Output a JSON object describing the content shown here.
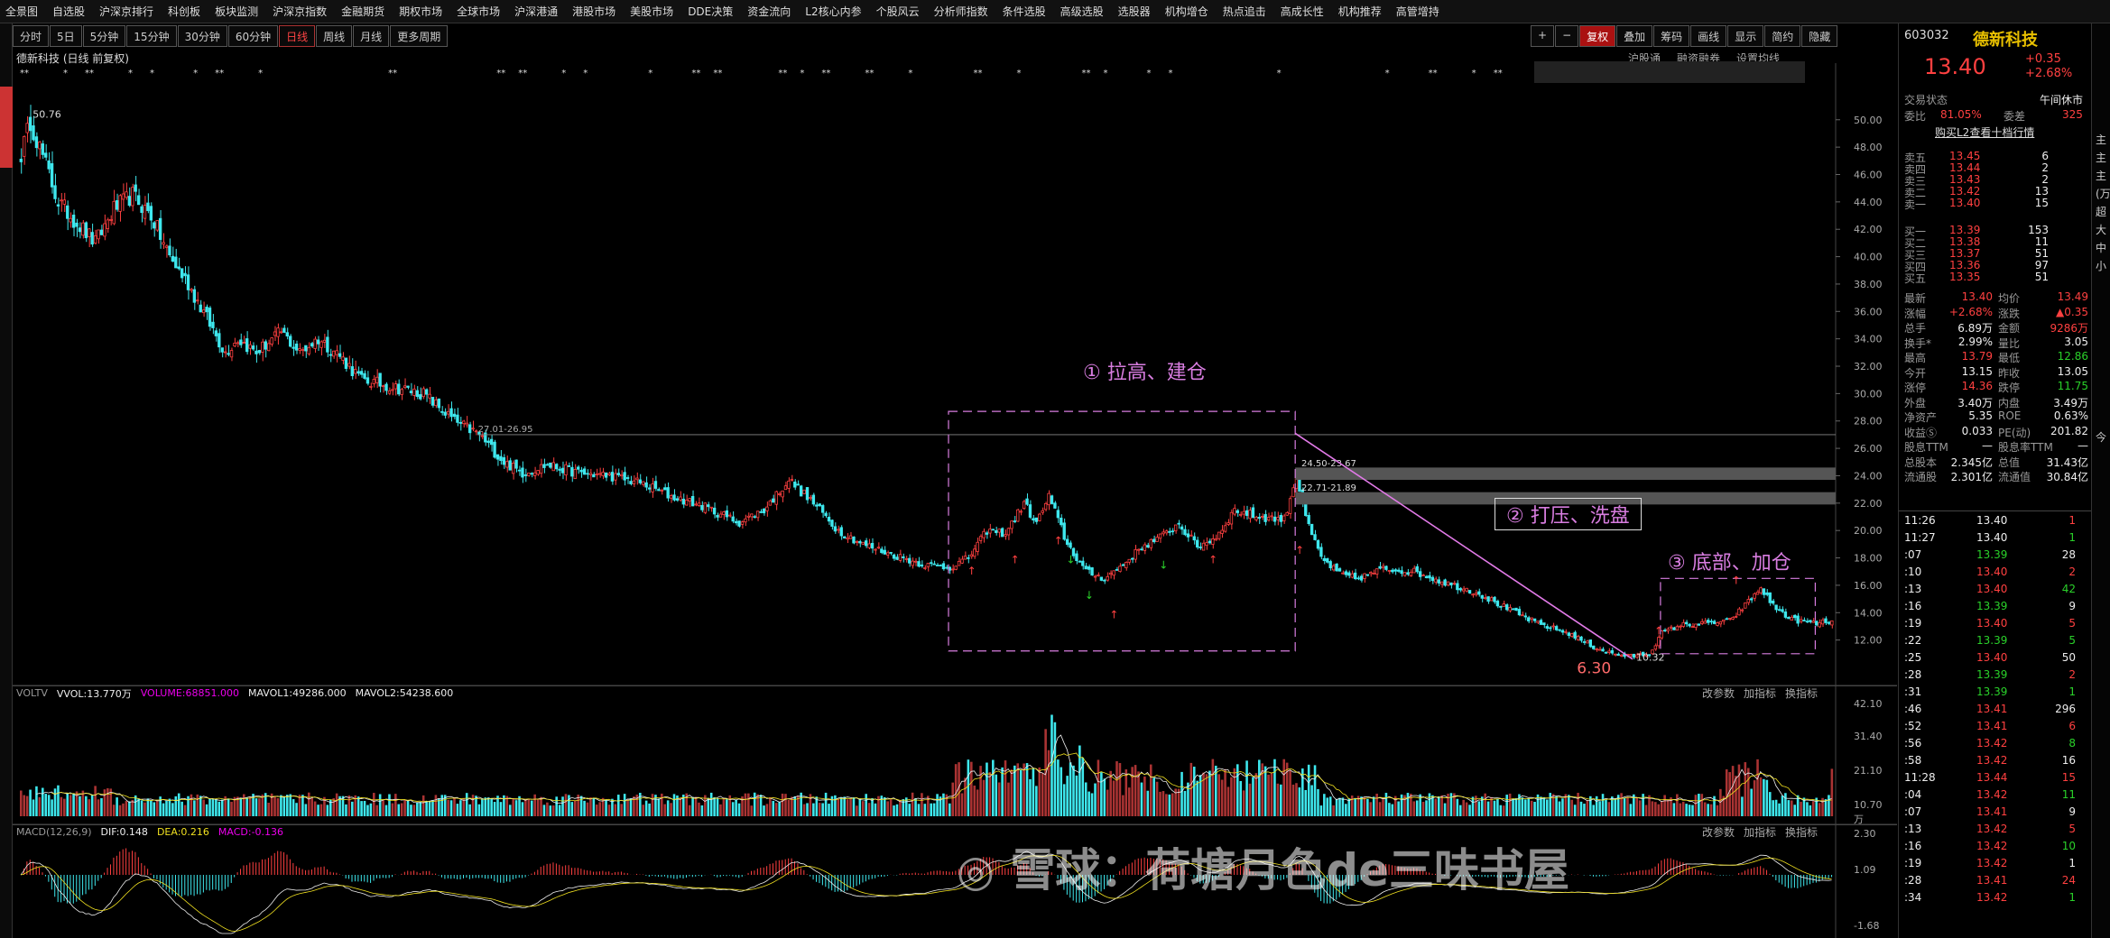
{
  "top_nav": [
    "全景图",
    "自选股",
    "沪深京排行",
    "科创板",
    "板块监测",
    "沪深京指数",
    "金融期货",
    "期权市场",
    "全球市场",
    "沪深港通",
    "港股市场",
    "美股市场",
    "DDE决策",
    "资金流向",
    "L2核心内参",
    "个股风云",
    "分析师指数",
    "条件选股",
    "高级选股",
    "选股器",
    "机构增仓",
    "热点追击",
    "高成长性",
    "机构推荐",
    "高管增持"
  ],
  "period_tabs": [
    "分时",
    "5日",
    "5分钟",
    "15分钟",
    "30分钟",
    "60分钟",
    "日线",
    "周线",
    "月线",
    "更多周期"
  ],
  "active_period": "日线",
  "chart_tools": [
    "+",
    "−",
    "复权",
    "叠加",
    "筹码",
    "画线",
    "显示",
    "简约",
    "隐藏"
  ],
  "chart_subtools": [
    "沪股通",
    "融资融券",
    "设置均线"
  ],
  "stock": {
    "title": "德新科技 (日线 前复权)",
    "code": "603032",
    "name": "德新科技",
    "price": "13.40",
    "change": "+0.35",
    "pct": "+2.68%"
  },
  "price_axis": [
    "50.00",
    "48.00",
    "46.00",
    "44.00",
    "42.00",
    "40.00",
    "38.00",
    "36.00",
    "34.00",
    "32.00",
    "30.00",
    "28.00",
    "26.00",
    "24.00",
    "22.00",
    "20.00",
    "18.00",
    "16.00",
    "14.00",
    "12.00"
  ],
  "price_labels": {
    "high": "50.76",
    "low1": "6.30",
    "low2": "10.32",
    "range1": "27.01-26.95",
    "range2": "24.50-23.67",
    "range3": "22.71-21.89"
  },
  "annotations": [
    "① 拉高、建仓",
    "② 打压、洗盘",
    "③ 底部、加仓"
  ],
  "vol_header": {
    "title": "VOLTV",
    "vvol": "VVOL:13.770万",
    "volume": "VOLUME:68851.000",
    "mavol1": "MAVOL1:49286.000",
    "mavol2": "MAVOL2:54238.600"
  },
  "vol_axis": [
    "42.10",
    "31.40",
    "21.10",
    "10.70",
    "万"
  ],
  "macd_header": {
    "title": "MACD(12,26,9)",
    "dif": "DIF:0.148",
    "dea": "DEA:0.216",
    "macd": "MACD:-0.136"
  },
  "macd_axis": [
    "2.30",
    "1.09",
    "-1.68"
  ],
  "sub_links": [
    "改参数",
    "加指标",
    "换指标"
  ],
  "watermark": "雪球：荷塘月色de三味书屋",
  "rp": {
    "status_label": "交易状态",
    "status": "午间休市",
    "ratio_label": "委比",
    "ratio": "81.05%",
    "diff_label": "委差",
    "diff": "325",
    "l2_link": "购买L2查看十档行情",
    "asks": [
      [
        "卖五",
        "13.45",
        "6"
      ],
      [
        "卖四",
        "13.44",
        "2"
      ],
      [
        "卖三",
        "13.43",
        "2"
      ],
      [
        "卖二",
        "13.42",
        "13"
      ],
      [
        "卖一",
        "13.40",
        "15"
      ]
    ],
    "bids": [
      [
        "买一",
        "13.39",
        "153"
      ],
      [
        "买二",
        "13.38",
        "11"
      ],
      [
        "买三",
        "13.37",
        "51"
      ],
      [
        "买四",
        "13.36",
        "97"
      ],
      [
        "买五",
        "13.35",
        "51"
      ]
    ],
    "stats": [
      [
        "最新",
        "13.40",
        "均价",
        "13.49"
      ],
      [
        "涨幅",
        "+2.68%",
        "涨跌",
        "▲0.35"
      ],
      [
        "总手",
        "6.89万",
        "金额",
        "9286万"
      ],
      [
        "换手*",
        "2.99%",
        "量比",
        "3.05"
      ],
      [
        "最高",
        "13.79",
        "最低",
        "12.86"
      ],
      [
        "今开",
        "13.15",
        "昨收",
        "13.05"
      ],
      [
        "涨停",
        "14.36",
        "跌停",
        "11.75"
      ],
      [
        "外盘",
        "3.40万",
        "内盘",
        "3.49万"
      ],
      [
        "净资产",
        "5.35",
        "ROE",
        "0.63%"
      ],
      [
        "收益Ⓢ",
        "0.033",
        "PE(动)",
        "201.82"
      ],
      [
        "股息TTM",
        "—",
        "股息率TTM",
        "—"
      ],
      [
        "总股本",
        "2.345亿",
        "总值",
        "31.43亿"
      ],
      [
        "流通股",
        "2.301亿",
        "流通值",
        "30.84亿"
      ]
    ],
    "ticks": [
      [
        "11:26",
        "13.40",
        "1"
      ],
      [
        "11:27",
        "13.40",
        "1"
      ],
      [
        ":07",
        "13.39",
        "28"
      ],
      [
        ":10",
        "13.40",
        "2"
      ],
      [
        ":13",
        "13.40",
        "42"
      ],
      [
        ":16",
        "13.39",
        "9"
      ],
      [
        ":19",
        "13.40",
        "5"
      ],
      [
        ":22",
        "13.39",
        "5"
      ],
      [
        ":25",
        "13.40",
        "50"
      ],
      [
        ":28",
        "13.39",
        "2"
      ],
      [
        ":31",
        "13.39",
        "1"
      ],
      [
        ":46",
        "13.41",
        "296"
      ],
      [
        ":52",
        "13.41",
        "6"
      ],
      [
        ":56",
        "13.42",
        "8"
      ],
      [
        ":58",
        "13.42",
        "16"
      ],
      [
        "11:28",
        "13.44",
        "15"
      ],
      [
        ":04",
        "13.42",
        "11"
      ],
      [
        ":07",
        "13.41",
        "9"
      ],
      [
        ":13",
        "13.42",
        "5"
      ],
      [
        ":16",
        "13.42",
        "10"
      ],
      [
        ":19",
        "13.42",
        "1"
      ],
      [
        ":28",
        "13.41",
        "24"
      ],
      [
        ":34",
        "13.42",
        "1"
      ]
    ]
  },
  "far_right": [
    "主",
    "主",
    "主",
    "(万",
    "超",
    "大",
    "中",
    "小",
    "",
    "",
    "",
    "",
    "",
    "",
    "今",
    "",
    "",
    "",
    "",
    "",
    "",
    "",
    "",
    "",
    "",
    "",
    "",
    "万",
    "",
    "",
    "",
    "",
    "",
    "今",
    "",
    "",
    "",
    "",
    "",
    "",
    "",
    "",
    "",
    "",
    "",
    "",
    "",
    "",
    "",
    "",
    "",
    "",
    "",
    "",
    "",
    "",
    "",
    "",
    "",
    "",
    "",
    "",
    "",
    "",
    "",
    "",
    "",
    "",
    "",
    "",
    "",
    "",
    "",
    "",
    "",
    "",
    "",
    "",
    "",
    "",
    "",
    "",
    "",
    "",
    "",
    "",
    "",
    "",
    "",
    "",
    "",
    "",
    "",
    "",
    "",
    "",
    "",
    "",
    "",
    "",
    "",
    "",
    "",
    "",
    "",
    ""
  ],
  "chart_data": {
    "type": "candlestick",
    "price_range": [
      10.0,
      51.5
    ],
    "anchors": [
      [
        0,
        47.5
      ],
      [
        3,
        49.9
      ],
      [
        6,
        48
      ],
      [
        12,
        44
      ],
      [
        18,
        42.5
      ],
      [
        24,
        41
      ],
      [
        30,
        43.5
      ],
      [
        36,
        44.5
      ],
      [
        42,
        43
      ],
      [
        48,
        40
      ],
      [
        54,
        38
      ],
      [
        60,
        35.5
      ],
      [
        66,
        33
      ],
      [
        70,
        34
      ],
      [
        76,
        33
      ],
      [
        84,
        34.5
      ],
      [
        90,
        33
      ],
      [
        96,
        34
      ],
      [
        102,
        33
      ],
      [
        110,
        31
      ],
      [
        120,
        30.5
      ],
      [
        130,
        30
      ],
      [
        140,
        28
      ],
      [
        148,
        27
      ],
      [
        156,
        25
      ],
      [
        162,
        24.2
      ],
      [
        170,
        24.8
      ],
      [
        180,
        24.2
      ],
      [
        190,
        24
      ],
      [
        200,
        23.5
      ],
      [
        210,
        22.5
      ],
      [
        220,
        21.8
      ],
      [
        232,
        20.6
      ],
      [
        240,
        21.5
      ],
      [
        248,
        23.7
      ],
      [
        256,
        22
      ],
      [
        264,
        20
      ],
      [
        272,
        19
      ],
      [
        282,
        18.2
      ],
      [
        292,
        17.5
      ],
      [
        300,
        17.3
      ],
      [
        306,
        18
      ],
      [
        312,
        20
      ],
      [
        318,
        19.8
      ],
      [
        324,
        22
      ],
      [
        328,
        20.5
      ],
      [
        332,
        22.5
      ],
      [
        338,
        19
      ],
      [
        344,
        17
      ],
      [
        350,
        16.5
      ],
      [
        356,
        17.5
      ],
      [
        362,
        18.8
      ],
      [
        368,
        19.5
      ],
      [
        374,
        20.5
      ],
      [
        380,
        18.8
      ],
      [
        386,
        19.5
      ],
      [
        392,
        21.5
      ],
      [
        400,
        21
      ],
      [
        408,
        20.8
      ],
      [
        412,
        24
      ],
      [
        416,
        20.2
      ],
      [
        420,
        18
      ],
      [
        426,
        16.8
      ],
      [
        432,
        16.5
      ],
      [
        440,
        17.2
      ],
      [
        450,
        17
      ],
      [
        460,
        16.2
      ],
      [
        470,
        15.5
      ],
      [
        480,
        14.3
      ],
      [
        490,
        13.2
      ],
      [
        500,
        12.5
      ],
      [
        508,
        11.5
      ],
      [
        514,
        11
      ],
      [
        520,
        10.8
      ],
      [
        526,
        11
      ],
      [
        530,
        12.5
      ],
      [
        536,
        13.1
      ],
      [
        544,
        13.2
      ],
      [
        552,
        13.4
      ],
      [
        558,
        14.8
      ],
      [
        562,
        15.8
      ],
      [
        566,
        14.5
      ],
      [
        572,
        13.5
      ],
      [
        580,
        13.2
      ],
      [
        585,
        13.4
      ]
    ],
    "n": 586,
    "volume_range": [
      0,
      42.1
    ],
    "macd_range": [
      -1.9,
      2.3
    ]
  }
}
